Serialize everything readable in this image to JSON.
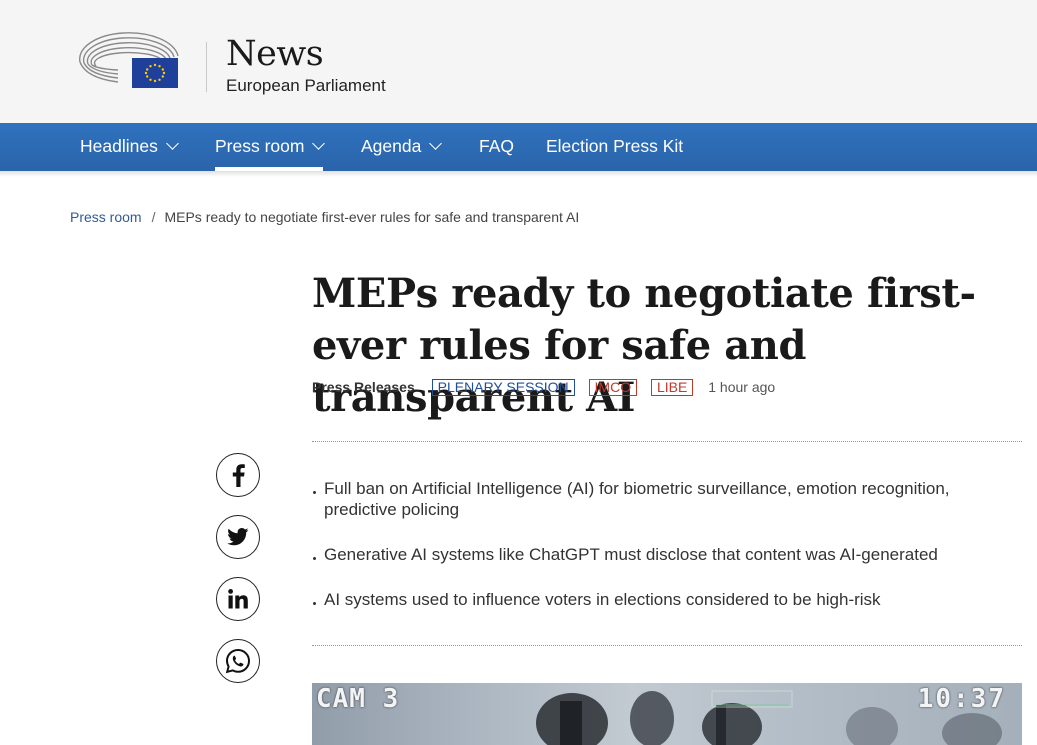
{
  "header": {
    "title": "News",
    "subtitle": "European Parliament"
  },
  "nav": {
    "items": [
      {
        "label": "Headlines",
        "has_dropdown": true,
        "active": false
      },
      {
        "label": "Press room",
        "has_dropdown": true,
        "active": true
      },
      {
        "label": "Agenda",
        "has_dropdown": true,
        "active": false
      },
      {
        "label": "FAQ",
        "has_dropdown": false,
        "active": false
      },
      {
        "label": "Election Press Kit",
        "has_dropdown": false,
        "active": false
      }
    ]
  },
  "breadcrumb": {
    "parent": "Press room",
    "separator": "/",
    "current": "MEPs ready to negotiate first-ever rules for safe and transparent AI"
  },
  "article": {
    "title": "MEPs ready to negotiate first-ever rules for safe and transparent AI",
    "type": "Press Releases",
    "tags": [
      "PLENARY SESSION",
      "IMCO",
      "LIBE"
    ],
    "time": "1 hour ago",
    "highlights": [
      "Full ban on Artificial Intelligence (AI) for biometric surveillance, emotion recognition, predictive policing",
      "Generative AI systems like ChatGPT must disclose that content was AI-generated",
      "AI systems used to influence voters in elections considered to be high-risk"
    ]
  },
  "share": [
    "facebook-icon",
    "twitter-icon",
    "linkedin-icon",
    "whatsapp-icon"
  ],
  "hero_image": {
    "cam_label": "CAM 3",
    "clock": "10:37"
  },
  "colors": {
    "nav_blue": "#2f72be",
    "tag_blue": "#1f4e9a",
    "tag_red": "#c0392b",
    "eu_blue": "#1e3f9a",
    "eu_gold": "#ffcc00"
  }
}
